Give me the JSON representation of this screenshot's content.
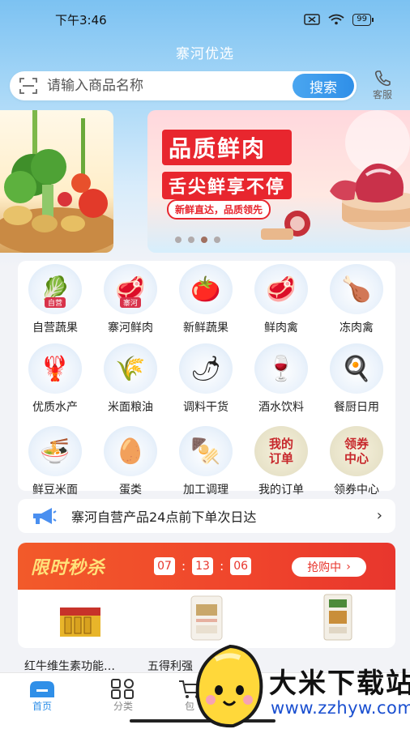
{
  "status_bar": {
    "time": "下午3:46",
    "battery": "99"
  },
  "app": {
    "title": "寨河优选"
  },
  "search": {
    "placeholder": "请输入商品名称",
    "button": "搜索"
  },
  "service": {
    "label": "客服"
  },
  "banner": {
    "title": "品质鲜肉",
    "subtitle": "舌尖鲜享不停",
    "tag": "新鲜直达，品质领先",
    "dots": 4,
    "active_dot": 3
  },
  "categories": [
    {
      "label": "自营蔬果",
      "icon": "vegetable-basket-icon",
      "badge": "自营"
    },
    {
      "label": "寨河鲜肉",
      "icon": "meat-plate-icon",
      "badge": "寨河"
    },
    {
      "label": "新鲜蔬果",
      "icon": "fruit-plate-icon"
    },
    {
      "label": "鲜肉禽",
      "icon": "steak-board-icon"
    },
    {
      "label": "冻肉禽",
      "icon": "roast-chicken-icon"
    },
    {
      "label": "优质水产",
      "icon": "seafood-pot-icon"
    },
    {
      "label": "米面粮油",
      "icon": "grain-basin-icon"
    },
    {
      "label": "调料干货",
      "icon": "spice-bowl-icon"
    },
    {
      "label": "酒水饮料",
      "icon": "wine-bottle-icon"
    },
    {
      "label": "餐厨日用",
      "icon": "kitchenware-icon"
    },
    {
      "label": "鲜豆米面",
      "icon": "noodle-bowl-icon"
    },
    {
      "label": "蛋类",
      "icon": "egg-nest-icon"
    },
    {
      "label": "加工调理",
      "icon": "skewer-plate-icon"
    },
    {
      "label": "我的订单",
      "icon": "my-orders-icon",
      "icon_text": "我的订单"
    },
    {
      "label": "领券中心",
      "icon": "coupon-center-icon",
      "icon_text": "领券中心"
    }
  ],
  "notice": {
    "text": "寨河自营产品24点前下单次日达"
  },
  "flash_sale": {
    "title": "限时秒杀",
    "hours": "07",
    "minutes": "13",
    "seconds": "06",
    "button": "抢购中",
    "products": [
      {
        "name": "红牛维生素功能…",
        "icon": "energy-drink-box-icon"
      },
      {
        "name": "五得利强",
        "icon": "flour-bag-icon"
      },
      {
        "name": "",
        "icon": "flour-sack-icon"
      }
    ]
  },
  "tabbar": {
    "tabs": [
      {
        "label": "首页",
        "icon": "home-icon",
        "active": true
      },
      {
        "label": "分类",
        "icon": "category-grid-icon",
        "active": false
      },
      {
        "label": "包",
        "icon": "cart-icon",
        "active": false
      }
    ]
  },
  "watermark": {
    "text": "大米下载站",
    "url": "www.zzhyw.com"
  },
  "colors": {
    "accent": "#2f8fe8",
    "flash_red": "#e8362d",
    "banner_red": "#e8262e"
  }
}
